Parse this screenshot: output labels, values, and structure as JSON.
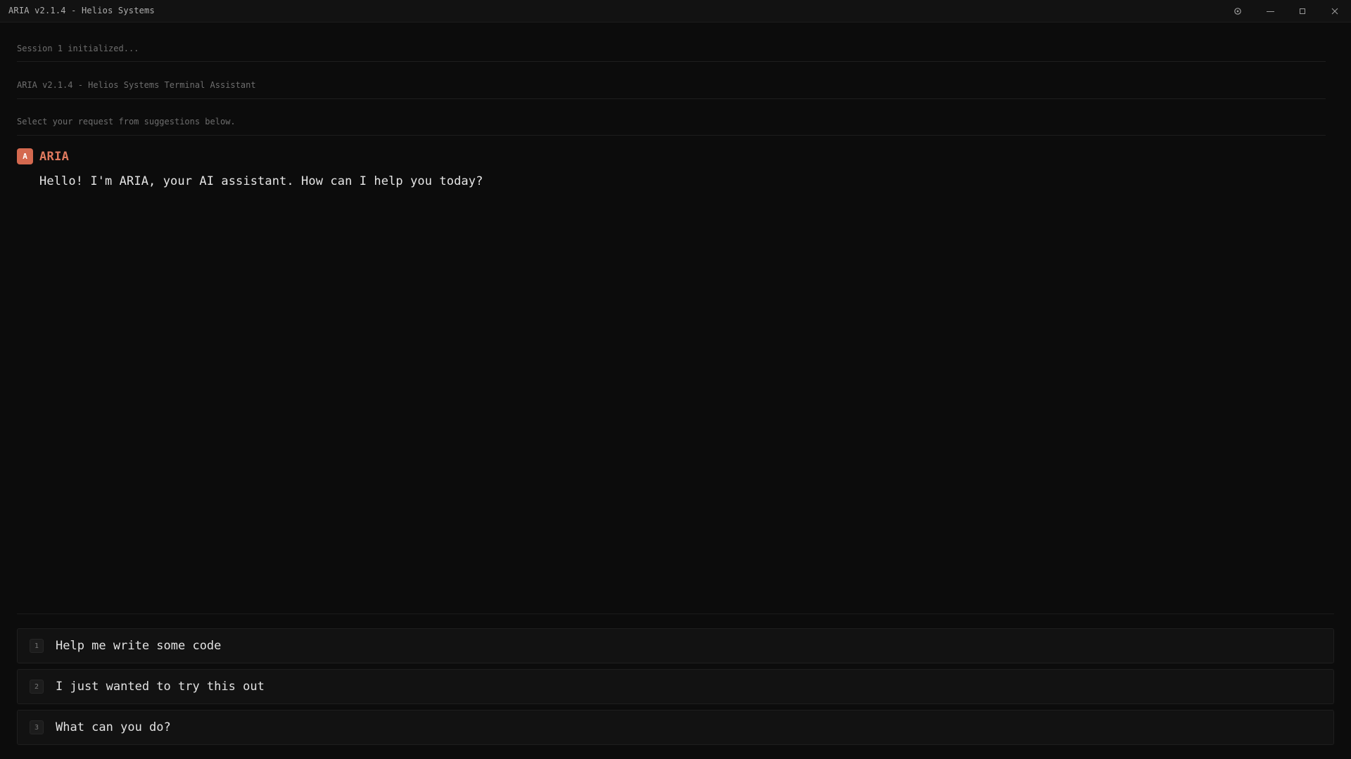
{
  "window": {
    "title": "ARIA v2.1.4 - Helios Systems",
    "controls": {
      "settings_icon": "gear-icon",
      "minimize_icon": "minimize-icon",
      "maximize_icon": "maximize-icon",
      "close_icon": "close-icon"
    }
  },
  "log": {
    "lines": [
      "Session 1 initialized...",
      "ARIA v2.1.4 - Helios Systems Terminal Assistant",
      "Select your request from suggestions below."
    ]
  },
  "message": {
    "avatar_letter": "A",
    "sender": "ARIA",
    "text": "Hello! I'm ARIA, your AI assistant. How can I help you today?"
  },
  "suggestions": [
    {
      "number": "1",
      "label": "Help me write some code"
    },
    {
      "number": "2",
      "label": "I just wanted to try this out"
    },
    {
      "number": "3",
      "label": "What can you do?"
    }
  ],
  "colors": {
    "background": "#0c0c0c",
    "accent": "#e07a5f",
    "avatar": "#d4694f"
  }
}
